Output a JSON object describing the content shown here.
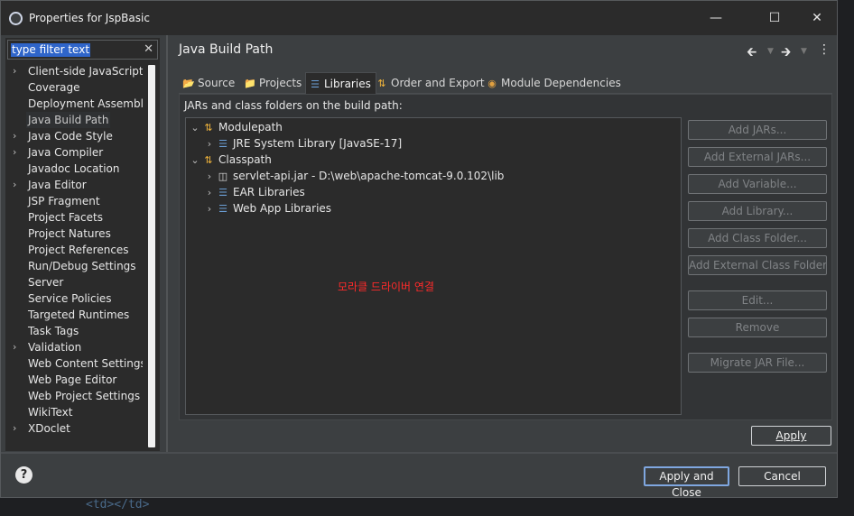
{
  "window": {
    "title": "Properties for JspBasic",
    "app_icon": "eclipse-icon",
    "controls": [
      "minimize-icon",
      "maximize-icon",
      "close-icon"
    ]
  },
  "filter": {
    "value": "type filter text",
    "clear_icon": "clear-icon"
  },
  "sidebar": {
    "items": [
      {
        "label": "Client-side JavaScript",
        "expandable": true
      },
      {
        "label": "Coverage",
        "expandable": false
      },
      {
        "label": "Deployment Assembly",
        "expandable": false
      },
      {
        "label": "Java Build Path",
        "expandable": false,
        "selected": true
      },
      {
        "label": "Java Code Style",
        "expandable": true
      },
      {
        "label": "Java Compiler",
        "expandable": true
      },
      {
        "label": "Javadoc Location",
        "expandable": false
      },
      {
        "label": "Java Editor",
        "expandable": true
      },
      {
        "label": "JSP Fragment",
        "expandable": false
      },
      {
        "label": "Project Facets",
        "expandable": false
      },
      {
        "label": "Project Natures",
        "expandable": false
      },
      {
        "label": "Project References",
        "expandable": false
      },
      {
        "label": "Run/Debug Settings",
        "expandable": false
      },
      {
        "label": "Server",
        "expandable": false
      },
      {
        "label": "Service Policies",
        "expandable": false
      },
      {
        "label": "Targeted Runtimes",
        "expandable": false
      },
      {
        "label": "Task Tags",
        "expandable": false
      },
      {
        "label": "Validation",
        "expandable": true
      },
      {
        "label": "Web Content Settings",
        "expandable": false
      },
      {
        "label": "Web Page Editor",
        "expandable": false
      },
      {
        "label": "Web Project Settings",
        "expandable": false
      },
      {
        "label": "WikiText",
        "expandable": false
      },
      {
        "label": "XDoclet",
        "expandable": true
      }
    ]
  },
  "page": {
    "title": "Java Build Path",
    "nav_icons": [
      "back-arrow-icon",
      "back-dropdown-icon",
      "forward-arrow-icon",
      "forward-dropdown-icon",
      "more-menu-icon"
    ]
  },
  "tabs": [
    {
      "label": "Source",
      "icon": "source-folder-icon",
      "active": false
    },
    {
      "label": "Projects",
      "icon": "projects-icon",
      "active": false
    },
    {
      "label": "Libraries",
      "icon": "libraries-icon",
      "active": true
    },
    {
      "label": "Order and Export",
      "icon": "order-export-icon",
      "active": false
    },
    {
      "label": "Module Dependencies",
      "icon": "module-icon",
      "active": false
    }
  ],
  "panel_label": "JARs and class folders on the build path:",
  "build_path": {
    "modulepath": {
      "label": "Modulepath",
      "children": [
        {
          "label": "JRE System Library [JavaSE-17]",
          "icon": "library-icon"
        }
      ]
    },
    "classpath": {
      "label": "Classpath",
      "children": [
        {
          "label": "servlet-api.jar - D:\\web\\apache-tomcat-9.0.102\\lib",
          "icon": "jar-icon"
        },
        {
          "label": "EAR Libraries",
          "icon": "library-icon"
        },
        {
          "label": "Web App Libraries",
          "icon": "library-icon"
        }
      ]
    }
  },
  "annotation": "모라클 드라이버 연결",
  "side_buttons": [
    "Add JARs...",
    "Add External JARs...",
    "Add Variable...",
    "Add Library...",
    "Add Class Folder...",
    "Add External Class Folder...",
    "Edit...",
    "Remove",
    "Migrate JAR File..."
  ],
  "apply_label": "Apply",
  "footer": {
    "apply_close_label": "Apply and Close",
    "cancel_label": "Cancel",
    "help_icon": "help-icon"
  },
  "background_code": "<td></td>"
}
